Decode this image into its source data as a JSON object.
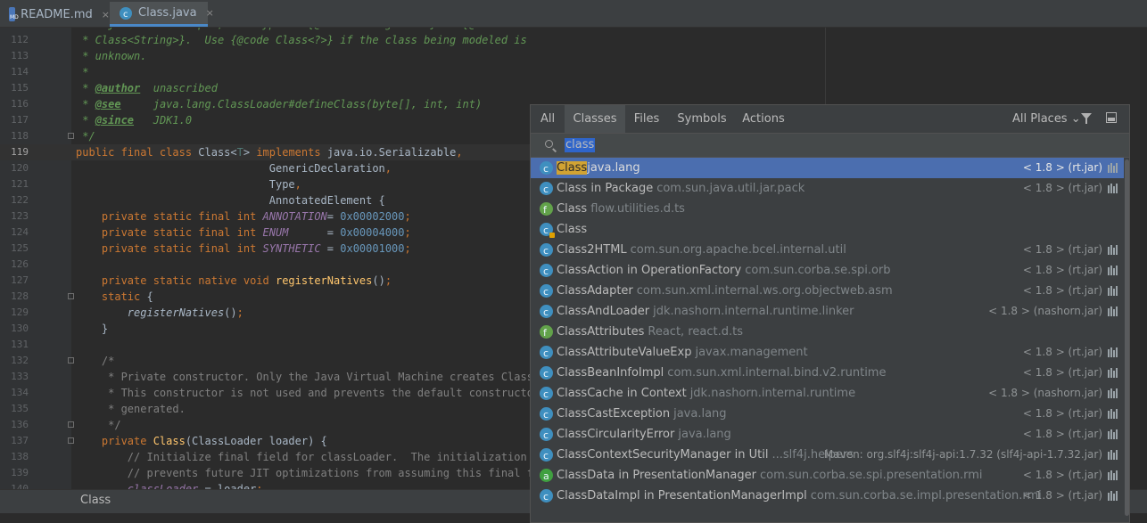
{
  "tabs": [
    {
      "label": "README.md",
      "close": "×",
      "active": false
    },
    {
      "label": "Class.java",
      "close": "×",
      "active": true
    }
  ],
  "editor": {
    "lines": [
      {
        "n": "111",
        "html": "<span class=\"cm\"> * object. For example, the type of {@code String.class} is {@code</span>",
        "cur": false,
        "fold": false
      },
      {
        "n": "112",
        "html": "<span class=\"cm\"> * Class&lt;String&gt;}.  Use {@code Class&lt;?&gt;} if the class being modeled is</span>",
        "cur": false,
        "fold": false
      },
      {
        "n": "113",
        "html": "<span class=\"cm\"> * unknown.</span>",
        "cur": false,
        "fold": false
      },
      {
        "n": "114",
        "html": "<span class=\"cm\"> *</span>",
        "cur": false,
        "fold": false
      },
      {
        "n": "115",
        "html": "<span class=\"cm\"> * </span><span class=\"tag\">@author</span><span class=\"cm\">  unascribed</span>",
        "cur": false,
        "fold": false
      },
      {
        "n": "116",
        "html": "<span class=\"cm\"> * </span><span class=\"tag\">@see</span><span class=\"cm\">     java.lang.ClassLoader#defineClass(byte[], int, int)</span>",
        "cur": false,
        "fold": false
      },
      {
        "n": "117",
        "html": "<span class=\"cm\"> * </span><span class=\"tag\">@since</span><span class=\"cm\">   JDK1.0</span>",
        "cur": false,
        "fold": false
      },
      {
        "n": "118",
        "html": "<span class=\"cm\"> */</span>",
        "cur": false,
        "fold": true
      },
      {
        "n": "119",
        "html": "<span class=\"kw\">public final class </span>Class&lt;<span class=\"tp\">T</span>&gt; <span class=\"kw\">implements </span>java.io.Serializable<span class=\"kw\">,</span>",
        "cur": true,
        "fold": false
      },
      {
        "n": "120",
        "html": "                              GenericDeclaration<span class=\"kw\">,</span>",
        "cur": false,
        "fold": false
      },
      {
        "n": "121",
        "html": "                              Type<span class=\"kw\">,</span>",
        "cur": false,
        "fold": false
      },
      {
        "n": "122",
        "html": "                              AnnotatedElement {",
        "cur": false,
        "fold": false
      },
      {
        "n": "123",
        "html": "    <span class=\"kw\">private static final int </span><span class=\"fld\">ANNOTATION</span>= <span class=\"num\">0x00002000</span><span class=\"kw\">;</span>",
        "cur": false,
        "fold": false
      },
      {
        "n": "124",
        "html": "    <span class=\"kw\">private static final int </span><span class=\"fld\">ENUM</span>      = <span class=\"num\">0x00004000</span><span class=\"kw\">;</span>",
        "cur": false,
        "fold": false
      },
      {
        "n": "125",
        "html": "    <span class=\"kw\">private static final int </span><span class=\"fld\">SYNTHETIC</span> = <span class=\"num\">0x00001000</span><span class=\"kw\">;</span>",
        "cur": false,
        "fold": false
      },
      {
        "n": "126",
        "html": "",
        "cur": false,
        "fold": false
      },
      {
        "n": "127",
        "html": "    <span class=\"kw\">private static native void </span><span class=\"fn\">registerNatives</span>()<span class=\"kw\">;</span>",
        "cur": false,
        "fold": false
      },
      {
        "n": "128",
        "html": "    <span class=\"kw\">static </span>{",
        "cur": false,
        "fold": true
      },
      {
        "n": "129",
        "html": "        <span class=\"it\">registerNatives</span>()<span class=\"kw\">;</span>",
        "cur": false,
        "fold": false
      },
      {
        "n": "130",
        "html": "    }",
        "cur": false,
        "fold": false
      },
      {
        "n": "131",
        "html": "",
        "cur": false,
        "fold": false
      },
      {
        "n": "132",
        "html": "    <span class=\"cmg\">/*</span>",
        "cur": false,
        "fold": true
      },
      {
        "n": "133",
        "html": "<span class=\"cmg\">     * Private constructor. Only the Java Virtual Machine creates Class objects.</span>",
        "cur": false,
        "fold": false
      },
      {
        "n": "134",
        "html": "<span class=\"cmg\">     * This constructor is not used and prevents the default constructor being</span>",
        "cur": false,
        "fold": false
      },
      {
        "n": "135",
        "html": "<span class=\"cmg\">     * generated.</span>",
        "cur": false,
        "fold": false
      },
      {
        "n": "136",
        "html": "<span class=\"cmg\">     */</span>",
        "cur": false,
        "fold": true
      },
      {
        "n": "137",
        "html": "    <span class=\"kw\">private </span><span class=\"fn\">Class</span>(ClassLoader loader) {",
        "cur": false,
        "fold": true
      },
      {
        "n": "138",
        "html": "<span class=\"cmg\">        // Initialize final field for classLoader.  The initialization value of non-null</span>",
        "cur": false,
        "fold": false
      },
      {
        "n": "139",
        "html": "<span class=\"cmg\">        // prevents future JIT optimizations from assuming this final field is null.</span>",
        "cur": false,
        "fold": false
      },
      {
        "n": "140",
        "html": "        <span class=\"fld\">classLoader </span>= loader<span class=\"kw\">;</span>",
        "cur": false,
        "fold": false
      }
    ]
  },
  "status": {
    "text": "Class"
  },
  "popup": {
    "tabs": [
      "All",
      "Classes",
      "Files",
      "Symbols",
      "Actions"
    ],
    "active_tab": "Classes",
    "scope_label": "All Places",
    "scope_arrow": "⌄",
    "query": "class",
    "results": [
      {
        "name_hl": "Class",
        "name_rest": "",
        "loc": "java.lang",
        "lib": "< 1.8 > (rt.jar)",
        "icon": "class",
        "selected": true
      },
      {
        "name_hl": "",
        "name_rest": "Class in Package",
        "loc": "com.sun.java.util.jar.pack",
        "lib": "< 1.8 > (rt.jar)",
        "icon": "class",
        "selected": false
      },
      {
        "name_hl": "",
        "name_rest": "Class",
        "loc": "flow.utilities.d.ts",
        "lib": "",
        "icon": "ts",
        "selected": false
      },
      {
        "name_hl": "",
        "name_rest": "Class",
        "loc": "",
        "lib": "",
        "icon": "class-lock",
        "selected": false
      },
      {
        "name_hl": "",
        "name_rest": "Class2HTML",
        "loc": "com.sun.org.apache.bcel.internal.util",
        "lib": "< 1.8 > (rt.jar)",
        "icon": "class",
        "selected": false
      },
      {
        "name_hl": "",
        "name_rest": "ClassAction in OperationFactory",
        "loc": "com.sun.corba.se.spi.orb",
        "lib": "< 1.8 > (rt.jar)",
        "icon": "class",
        "selected": false
      },
      {
        "name_hl": "",
        "name_rest": "ClassAdapter",
        "loc": "com.sun.xml.internal.ws.org.objectweb.asm",
        "lib": "< 1.8 > (rt.jar)",
        "icon": "class",
        "selected": false
      },
      {
        "name_hl": "",
        "name_rest": "ClassAndLoader",
        "loc": "jdk.nashorn.internal.runtime.linker",
        "lib": "< 1.8 > (nashorn.jar)",
        "icon": "class",
        "selected": false
      },
      {
        "name_hl": "",
        "name_rest": "ClassAttributes",
        "loc": "React, react.d.ts",
        "lib": "",
        "icon": "ts",
        "selected": false
      },
      {
        "name_hl": "",
        "name_rest": "ClassAttributeValueExp",
        "loc": "javax.management",
        "lib": "< 1.8 > (rt.jar)",
        "icon": "class",
        "selected": false
      },
      {
        "name_hl": "",
        "name_rest": "ClassBeanInfoImpl",
        "loc": "com.sun.xml.internal.bind.v2.runtime",
        "lib": "< 1.8 > (rt.jar)",
        "icon": "class",
        "selected": false
      },
      {
        "name_hl": "",
        "name_rest": "ClassCache in Context",
        "loc": "jdk.nashorn.internal.runtime",
        "lib": "< 1.8 > (nashorn.jar)",
        "icon": "class",
        "selected": false
      },
      {
        "name_hl": "",
        "name_rest": "ClassCastException",
        "loc": "java.lang",
        "lib": "< 1.8 > (rt.jar)",
        "icon": "class",
        "selected": false
      },
      {
        "name_hl": "",
        "name_rest": "ClassCircularityError",
        "loc": "java.lang",
        "lib": "< 1.8 > (rt.jar)",
        "icon": "class",
        "selected": false
      },
      {
        "name_hl": "",
        "name_rest": "ClassContextSecurityManager in Util",
        "loc": "...slf4j.helpers",
        "lib": "Maven: org.slf4j:slf4j-api:1.7.32 (slf4j-api-1.7.32.jar)",
        "icon": "class",
        "selected": false
      },
      {
        "name_hl": "",
        "name_rest": "ClassData in PresentationManager",
        "loc": "com.sun.corba.se.spi.presentation.rmi",
        "lib": "< 1.8 > (rt.jar)",
        "icon": "abs",
        "selected": false
      },
      {
        "name_hl": "",
        "name_rest": "ClassDataImpl in PresentationManagerImpl",
        "loc": "com.sun.corba.se.impl.presentation.rmi",
        "lib": "< 1.8 > (rt.jar)",
        "icon": "class",
        "selected": false
      }
    ]
  },
  "colors": {
    "editor_bg": "#2b2b2b",
    "keyword": "#cc7832",
    "doc_comment": "#629755",
    "selection": "#4b6eaf",
    "match_highlight": "#d1a333"
  }
}
